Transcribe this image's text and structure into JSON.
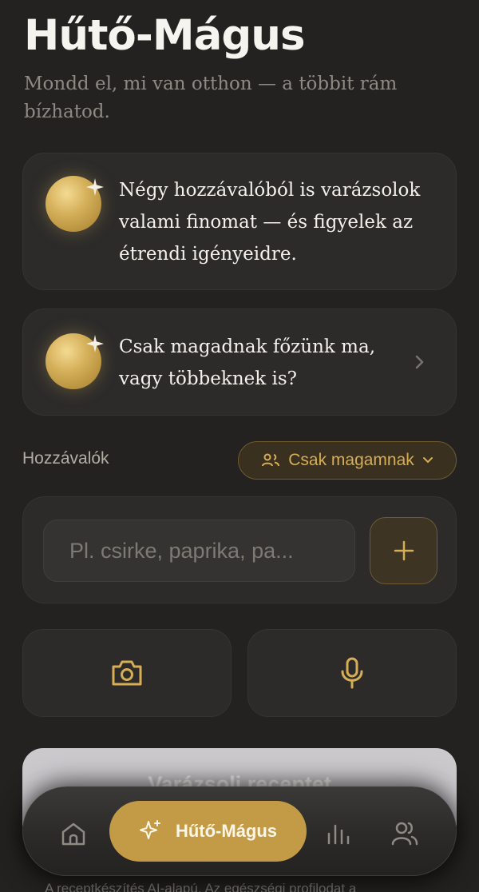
{
  "header": {
    "title": "Hűtő-Mágus",
    "subtitle": "Mondd el, mi van otthon — a többit rám bízhatod."
  },
  "cards": {
    "intro_text": "Négy hozzávalóból is varázsolok valami finomat — és figyelek az étrendi igényeidre.",
    "question_text": "Csak magadnak főzünk ma, vagy többeknek is?"
  },
  "ingredients": {
    "label": "Hozzávalók",
    "serving_pill": "Csak magamnak",
    "input_placeholder": "Pl. csirke, paprika, pa..."
  },
  "cta": {
    "label": "Varázsolj receptet"
  },
  "nav": {
    "active_label": "Hűtő-Mágus"
  },
  "footer": {
    "note": "A receptkészítés AI-alapú. Az egészségi profilodat a"
  },
  "colors": {
    "accent": "#c39b46",
    "background": "#242220",
    "card": "#2c2b2a"
  }
}
